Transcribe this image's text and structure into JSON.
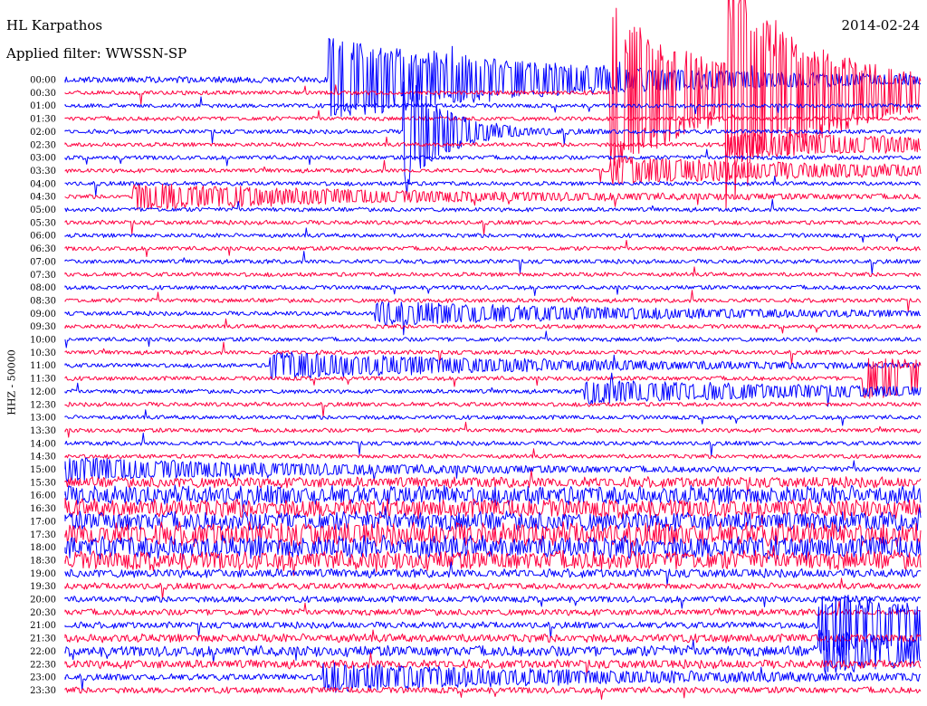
{
  "chart_data": {
    "type": "line",
    "title": "HL Karpathos",
    "date": "2014-02-24",
    "subtitle": "Applied filter: WWSSN-SP",
    "ylabel": "HHZ - 50000",
    "colors": [
      "#0000ff",
      "#ff0040"
    ],
    "y_tick_labels": [
      "00:00",
      "00:30",
      "01:00",
      "01:30",
      "02:00",
      "02:30",
      "03:00",
      "03:30",
      "04:00",
      "04:30",
      "05:00",
      "05:30",
      "06:00",
      "06:30",
      "07:00",
      "07:30",
      "08:00",
      "08:30",
      "09:00",
      "09:30",
      "10:00",
      "10:30",
      "11:00",
      "11:30",
      "12:00",
      "12:30",
      "13:00",
      "13:30",
      "14:00",
      "14:30",
      "15:00",
      "15:30",
      "16:00",
      "16:30",
      "17:00",
      "17:30",
      "18:00",
      "18:30",
      "19:00",
      "19:30",
      "20:00",
      "20:30",
      "21:00",
      "21:30",
      "22:00",
      "22:30",
      "23:00",
      "23:30"
    ],
    "row_noise": [
      3,
      2,
      2,
      2,
      2,
      2,
      2,
      2,
      2,
      2,
      2,
      2,
      2,
      2,
      2,
      2,
      2,
      2,
      2,
      2,
      2,
      2,
      2,
      2,
      2,
      2,
      2,
      2,
      2,
      2,
      2,
      5,
      9,
      9,
      9,
      11,
      11,
      9,
      4,
      3,
      3,
      3,
      3,
      4,
      5,
      4,
      3,
      3
    ],
    "events": [
      {
        "row": 4,
        "x_fraction": 0.398,
        "amplitude": 70,
        "decay": 0.045
      },
      {
        "row": 1,
        "x_fraction": 0.64,
        "amplitude": 95,
        "decay": 0.12
      },
      {
        "row": 1,
        "x_fraction": 0.775,
        "amplitude": 95,
        "decay": 0.12
      },
      {
        "row": 5,
        "x_fraction": 0.775,
        "amplitude": 14,
        "decay": 0.3
      },
      {
        "row": 7,
        "x_fraction": 0.64,
        "amplitude": 14,
        "decay": 0.3
      },
      {
        "row": 0,
        "x_fraction": 0.31,
        "amplitude": 45,
        "decay": 0.25
      },
      {
        "row": 9,
        "x_fraction": 0.082,
        "amplitude": 14,
        "decay": 0.3
      },
      {
        "row": 18,
        "x_fraction": 0.365,
        "amplitude": 12,
        "decay": 0.3
      },
      {
        "row": 22,
        "x_fraction": 0.242,
        "amplitude": 14,
        "decay": 0.3
      },
      {
        "row": 23,
        "x_fraction": 0.935,
        "amplitude": 22,
        "decay": 0.3
      },
      {
        "row": 24,
        "x_fraction": 0.61,
        "amplitude": 12,
        "decay": 0.3
      },
      {
        "row": 30,
        "x_fraction": 0.0,
        "amplitude": 12,
        "decay": 0.3
      },
      {
        "row": 42,
        "x_fraction": 0.883,
        "amplitude": 36,
        "decay": 0.2
      },
      {
        "row": 44,
        "x_fraction": 0.883,
        "amplitude": 22,
        "decay": 0.2
      },
      {
        "row": 46,
        "x_fraction": 0.304,
        "amplitude": 14,
        "decay": 0.3
      }
    ],
    "grid": false
  }
}
